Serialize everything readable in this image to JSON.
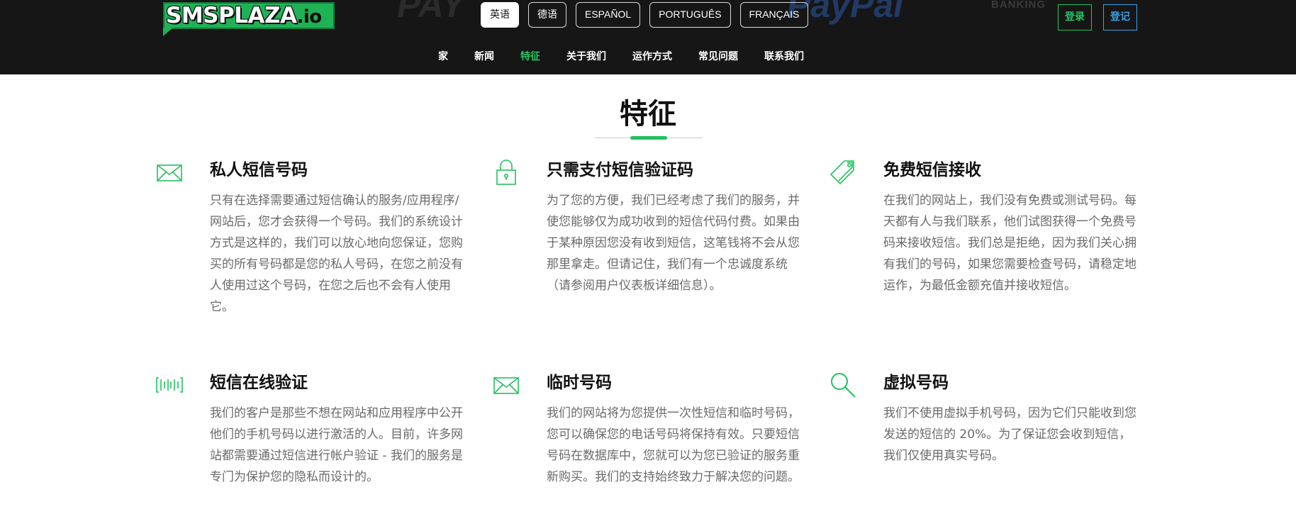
{
  "header": {
    "ghost_text": [
      "PAY",
      "PayPal",
      "BANKING"
    ],
    "logo": {
      "main": "SMSPLAZA",
      "suffix": ".io"
    },
    "languages": [
      {
        "label": "英语",
        "active": true
      },
      {
        "label": "德语",
        "active": false
      },
      {
        "label": "ESPAÑOL",
        "active": false
      },
      {
        "label": "PORTUGUÊS",
        "active": false
      },
      {
        "label": "FRANÇAIS",
        "active": false
      }
    ],
    "login_label": "登录",
    "register_label": "登记",
    "nav": [
      {
        "label": "家",
        "active": false
      },
      {
        "label": "新闻",
        "active": false
      },
      {
        "label": "特征",
        "active": true
      },
      {
        "label": "关于我们",
        "active": false
      },
      {
        "label": "运作方式",
        "active": false
      },
      {
        "label": "常见问题",
        "active": false
      },
      {
        "label": "联系我们",
        "active": false
      }
    ]
  },
  "colors": {
    "header_bg": "#161616",
    "accent_green": "#21c25e",
    "register_blue": "#3aa0e8",
    "text_muted": "#6a6a6a"
  },
  "section": {
    "title": "特征"
  },
  "features": [
    {
      "icon": "envelope-icon",
      "title": "私人短信号码",
      "text": "只有在选择需要通过短信确认的服务/应用程序/网站后，您才会获得一个号码。我们的系统设计方式是这样的，我们可以放心地向您保证，您购买的所有号码都是您的私人号码，在您之前没有人使用过这个号码，在您之后也不会有人使用它。"
    },
    {
      "icon": "padlock-icon",
      "title": "只需支付短信验证码",
      "text": "为了您的方便，我们已经考虑了我们的服务，并使您能够仅为成功收到的短信代码付费。如果由于某种原因您没有收到短信，这笔钱将不会从您那里拿走。但请记住，我们有一个忠诚度系统（请参阅用户仪表板详细信息）。"
    },
    {
      "icon": "price-tag-icon",
      "title": "免费短信接收",
      "text": "在我们的网站上，我们没有免费或测试号码。每天都有人与我们联系，他们试图获得一个免费号码来接收短信。我们总是拒绝，因为我们关心拥有我们的号码，如果您需要检查号码，请稳定地运作，为最低金额充值并接收短信。"
    },
    {
      "icon": "barcode-icon",
      "title": "短信在线验证",
      "text": "我们的客户是那些不想在网站和应用程序中公开他们的手机号码以进行激活的人。目前，许多网站都需要通过短信进行帐户验证 - 我们的服务是专门为保护您的隐私而设计的。"
    },
    {
      "icon": "envelope-icon",
      "title": "临时号码",
      "text": "我们的网站将为您提供一次性短信和临时号码，您可以确保您的电话号码将保持有效。只要短信号码在数据库中，您就可以为您已验证的服务重新购买。我们的支持始终致力于解决您的问题。"
    },
    {
      "icon": "magnifier-icon",
      "title": "虚拟号码",
      "text": "我们不使用虚拟手机号码，因为它们只能收到您发送的短信的 20%。为了保证您会收到短信，我们仅使用真实号码。"
    }
  ]
}
